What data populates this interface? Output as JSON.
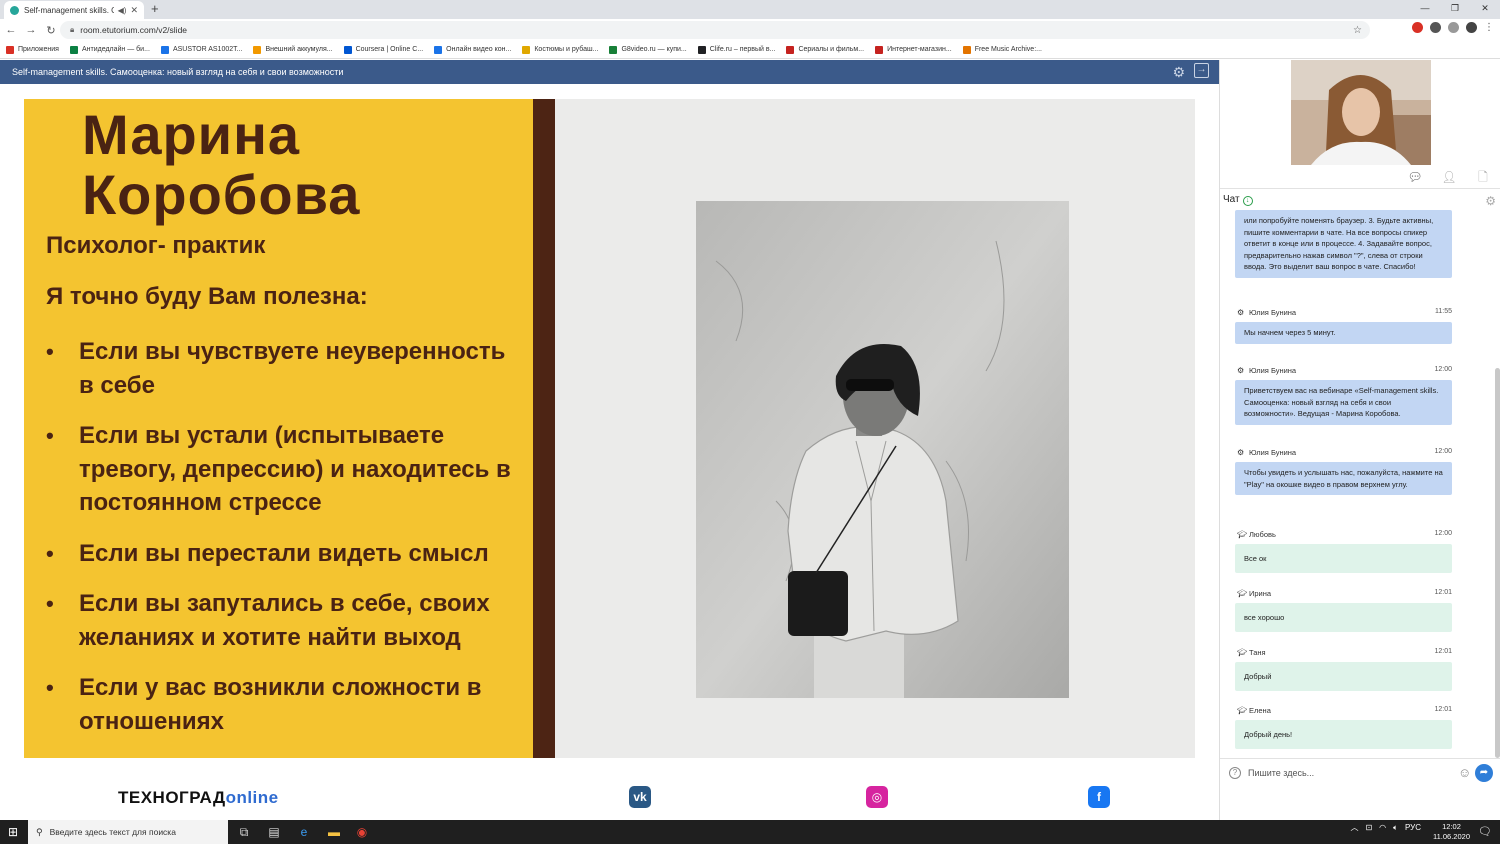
{
  "browser": {
    "tab_title": "Self-management skills. Сам",
    "url": "room.etutorium.com/v2/slide",
    "bookmarks": [
      {
        "label": "Приложения",
        "color": "#d93025"
      },
      {
        "label": "Антидедлайн — би...",
        "color": "#0b8043"
      },
      {
        "label": "ASUSTOR AS1002T...",
        "color": "#1a73e8"
      },
      {
        "label": "Внешний аккумуля...",
        "color": "#f29900"
      },
      {
        "label": "Coursera | Online C...",
        "color": "#0056d2"
      },
      {
        "label": "Онлайн видео кон...",
        "color": "#1a73e8"
      },
      {
        "label": "Костюмы и рубаш...",
        "color": "#e0a800"
      },
      {
        "label": "G8video.ru — купи...",
        "color": "#188038"
      },
      {
        "label": "Clife.ru – первый в...",
        "color": "#202124"
      },
      {
        "label": "Сериалы и фильм...",
        "color": "#c5221f"
      },
      {
        "label": "Интернет-магазин...",
        "color": "#c5221f"
      },
      {
        "label": "Free Music Archive:...",
        "color": "#e37400"
      }
    ]
  },
  "app": {
    "header_title": "Self-management skills. Самооценка: новый взгляд на себя и свои возможности"
  },
  "slide": {
    "name": "Марина Коробова",
    "role": "Психолог- практик",
    "heading": "Я точно буду Вам полезна:",
    "bullets": [
      "Если вы чувствуете неуверенность в себе",
      "Если вы устали (испытываете тревогу, депрессию) и находитесь в постоянном стрессе",
      "Если вы перестали видеть смысл",
      "Если вы запутались в себе, своих желаниях и хотите найти выход",
      "Если у вас возникли сложности в отношениях"
    ]
  },
  "footer": {
    "logo_main": "ТЕХНОГРАД",
    "logo_suffix": "online",
    "social": [
      {
        "name": "vk",
        "glyph": "vk",
        "color": "#2a5885"
      },
      {
        "name": "instagram",
        "glyph": "◎",
        "color": "#d6249f"
      },
      {
        "name": "facebook",
        "glyph": "f",
        "color": "#1877f2"
      }
    ]
  },
  "chat": {
    "label": "Чат",
    "messages": [
      {
        "author": "",
        "time": "",
        "text": "или попробуйте поменять браузер. 3. Будьте активны, пишите комментарии в чате. На все вопросы спикер ответит в конце или в процессе. 4. Задавайте вопрос, предварительно нажав символ \"?\", слева от строки ввода. Это выделит ваш вопрос в чате. Спасибо!",
        "role": "admin"
      },
      {
        "author": "Юлия Бунина",
        "time": "11:55",
        "text": "Мы начнем через 5 минут.",
        "role": "admin"
      },
      {
        "author": "Юлия Бунина",
        "time": "12:00",
        "text": "Приветствуем вас на вебинаре «Self-management skills. Самооценка: новый взгляд на себя и свои возможности». Ведущая - Марина Коробова.",
        "role": "admin"
      },
      {
        "author": "Юлия Бунина",
        "time": "12:00",
        "text": "Чтобы увидеть и услышать нас, пожалуйста, нажмите на \"Play\" на окошке видео в правом верхнем углу.",
        "role": "admin"
      },
      {
        "author": "Любовь",
        "time": "12:00",
        "text": "Все ок",
        "role": "user"
      },
      {
        "author": "Ирина",
        "time": "12:01",
        "text": "все хорошо",
        "role": "user"
      },
      {
        "author": "Таня",
        "time": "12:01",
        "text": "Добрый",
        "role": "user"
      },
      {
        "author": "Елена",
        "time": "12:01",
        "text": "Добрый день!",
        "role": "user"
      }
    ],
    "input_placeholder": "Пишите здесь..."
  },
  "taskbar": {
    "search_placeholder": "Введите здесь текст для поиска",
    "lang": "РУС",
    "time": "12:02",
    "date": "11.06.2020"
  }
}
